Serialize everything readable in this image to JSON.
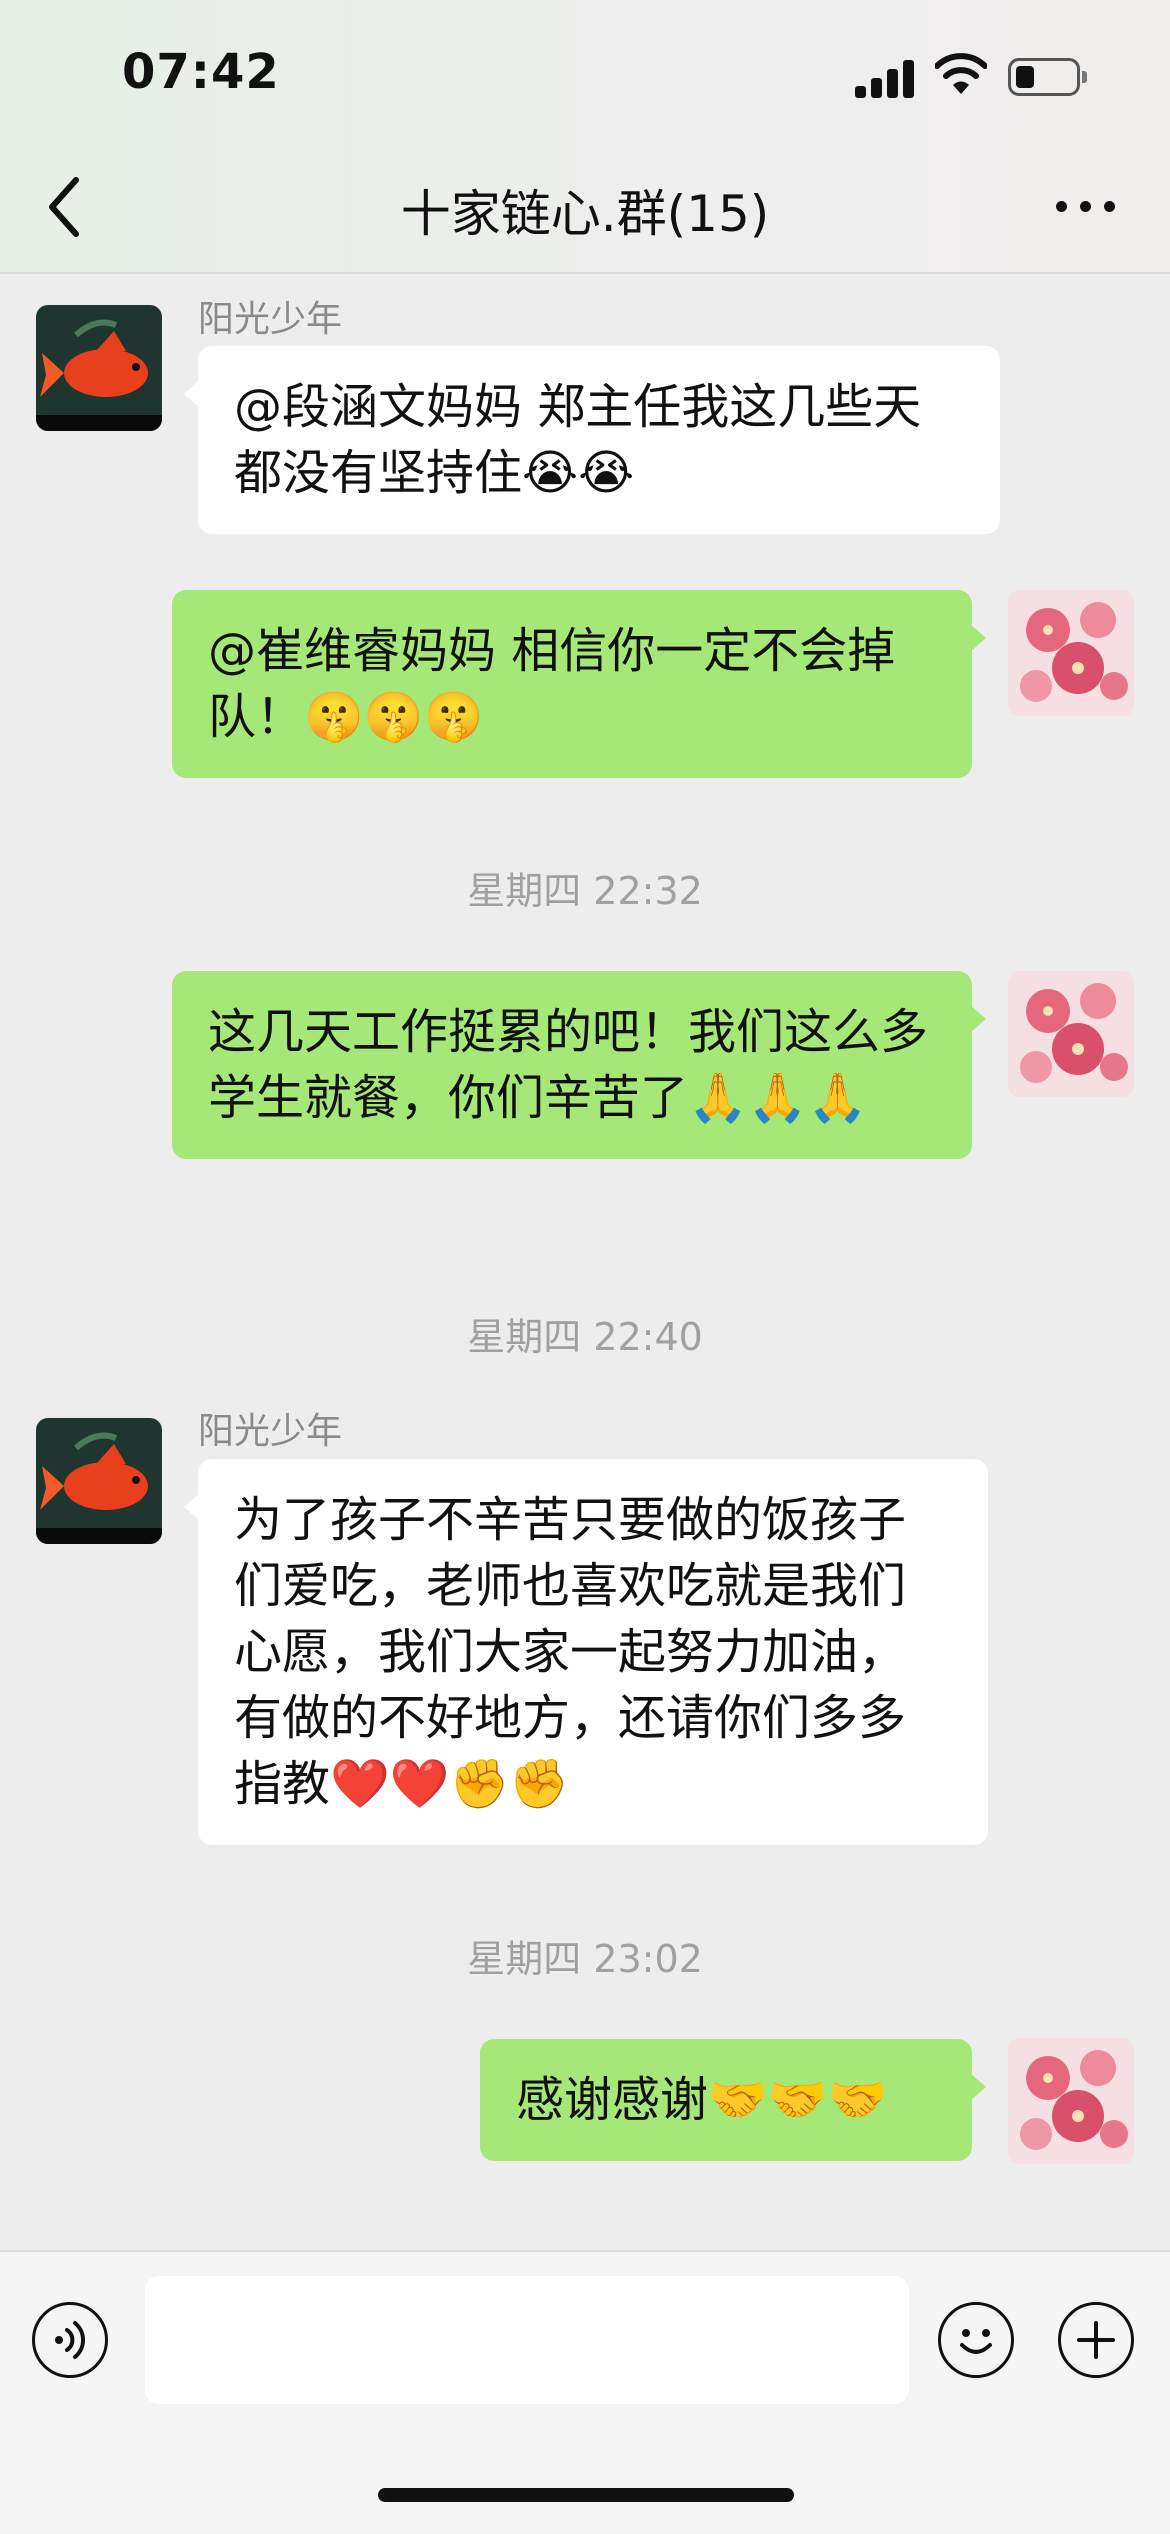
{
  "status": {
    "time": "07:42"
  },
  "header": {
    "title": "十家链心.群(15)"
  },
  "messages": [
    {
      "sender": "阳光少年",
      "text": "@段涵文妈妈 郑主任我这几些天都没有坚持住😭😭"
    },
    {
      "text": "@崔维睿妈妈 相信你一定不会掉队！🤫🤫🤫"
    },
    {
      "text": "这几天工作挺累的吧！我们这么多学生就餐，你们辛苦了🙏🙏🙏"
    },
    {
      "sender": "阳光少年",
      "text": "为了孩子不辛苦只要做的饭孩子们爱吃，老师也喜欢吃就是我们心愿，我们大家一起努力加油，有做的不好地方，还请你们多多指教❤️❤️✊✊"
    },
    {
      "text": "感谢感谢🤝🤝🤝"
    }
  ],
  "timestamps": [
    "星期四 22:32",
    "星期四 22:40",
    "星期四 23:02"
  ],
  "colors": {
    "outgoing_bubble": "#a6e878",
    "incoming_bubble": "#ffffff",
    "background": "#ededed"
  },
  "icons": [
    "back-chevron-icon",
    "more-dots-icon",
    "voice-icon",
    "emoji-icon",
    "plus-icon"
  ]
}
